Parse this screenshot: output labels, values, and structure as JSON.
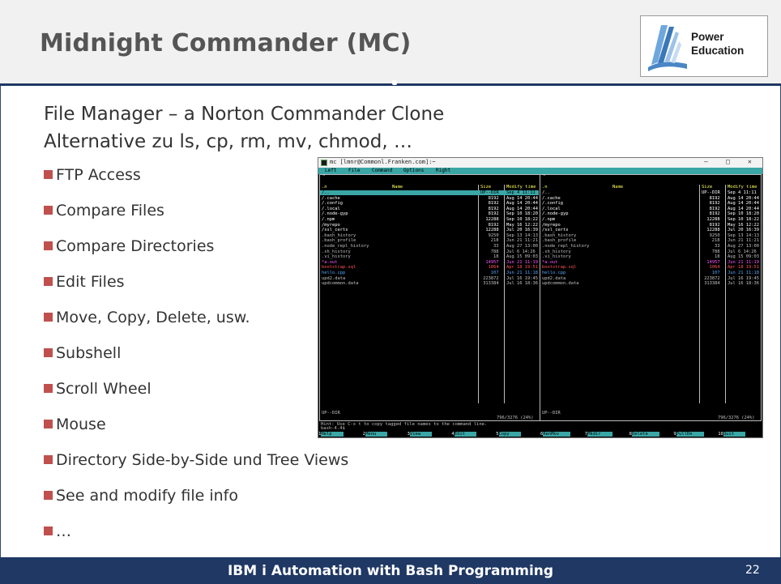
{
  "slide": {
    "title": "Midnight Commander (MC)",
    "subtitle_lines": [
      "File Manager – a Norton Commander Clone",
      "Alternative zu ls, cp, rm, mv, chmod, …"
    ],
    "bullets": [
      "FTP Access",
      "Compare Files",
      "Compare Directories",
      "Edit Files",
      "Move, Copy, Delete, usw.",
      "Subshell",
      "Scroll Wheel",
      "Mouse",
      "Directory Side-by-Side und Tree Views",
      "See and modify file info",
      "…"
    ],
    "bullet_color": "#c0504d",
    "footer_text": "IBM i Automation with Bash Programming",
    "page_number": "22",
    "logo": {
      "line1": "Power",
      "line2": "Education"
    },
    "colors": {
      "footer": "#1f3864",
      "header_bg": "#f1f1f1",
      "title": "#555555"
    }
  },
  "terminal": {
    "window_title": "mc [lmnr@Commonl.Franken.com]:~",
    "controls": [
      "–",
      "□",
      "✕"
    ],
    "menu": [
      "Left",
      "File",
      "Command",
      "Options",
      "Right"
    ],
    "panel_cwd_left": "~",
    "panel_cwd_right": "~",
    "col_headers": {
      "n": ".n",
      "name": "Name",
      "size": "Size",
      "mtime": "Modify time"
    },
    "files": [
      {
        "name": "/..",
        "size": "UP--DIR",
        "time": "Sep  4 11:11",
        "type": "dir"
      },
      {
        "name": "/.cache",
        "size": "8192",
        "time": "Aug 14 20:44",
        "type": "dir"
      },
      {
        "name": "/.config",
        "size": "8192",
        "time": "Aug 14 20:44",
        "type": "dir"
      },
      {
        "name": "/.local",
        "size": "8192",
        "time": "Aug 14 20:44",
        "type": "dir"
      },
      {
        "name": "/.node-gyp",
        "size": "8192",
        "time": "Sep 10 18:20",
        "type": "dir"
      },
      {
        "name": "/.npm",
        "size": "12288",
        "time": "Sep 10 18:22",
        "type": "dir"
      },
      {
        "name": "/myrepo",
        "size": "8192",
        "time": "May 16 12:22",
        "type": "dir"
      },
      {
        "name": "/ssl_certs",
        "size": "12288",
        "time": "Jul 20 16:39",
        "type": "dir"
      },
      {
        "name": ".bash_history",
        "size": "9250",
        "time": "Sep 13 14:13",
        "type": "file"
      },
      {
        "name": ".bash_profile",
        "size": "218",
        "time": "Jun 21 11:21",
        "type": "file"
      },
      {
        "name": ".node_repl_history",
        "size": "33",
        "time": "Aug 27 13:00",
        "type": "file"
      },
      {
        "name": ".sh_history",
        "size": "788",
        "time": "Jul  6 14:26",
        "type": "file"
      },
      {
        "name": ".vi_history",
        "size": "18",
        "time": "Aug 15 09:03",
        "type": "file"
      },
      {
        "name": "*a.out",
        "size": "14957",
        "time": "Jun 21 11:19",
        "type": "exec"
      },
      {
        "name": " bootstrap.sql",
        "size": "1064",
        "time": "Apr 18 19:51",
        "type": "red"
      },
      {
        "name": " hello.cpp",
        "size": "107",
        "time": "Jun 21 11:18",
        "type": "src"
      },
      {
        "name": " upd2.data",
        "size": "223872",
        "time": "Jul 16 19:45",
        "type": "file"
      },
      {
        "name": " updcommon.data",
        "size": "313384",
        "time": "Jul 16 18:36",
        "type": "file"
      }
    ],
    "status_left": "UP--DIR",
    "status_right": "796/3276 (24%)",
    "hint": "Hint: Use C-x t to copy tagged file names to the command line.",
    "prompt": "bash-4.4$",
    "fkeys": [
      {
        "num": "1",
        "label": "Help"
      },
      {
        "num": "2",
        "label": "Menu"
      },
      {
        "num": "3",
        "label": "View"
      },
      {
        "num": "4",
        "label": "Edit"
      },
      {
        "num": "5",
        "label": "Copy"
      },
      {
        "num": "6",
        "label": "RenMov"
      },
      {
        "num": "7",
        "label": "Mkdir"
      },
      {
        "num": "8",
        "label": "Delete"
      },
      {
        "num": "9",
        "label": "PullDn"
      },
      {
        "num": "10",
        "label": "Quit"
      }
    ],
    "colors": {
      "dir": "#ffffff",
      "file": "#c0c0c0",
      "exec": "#ff55ff",
      "red": "#ff5555",
      "src": "#55aaff",
      "cyan": "#3aa6a6"
    }
  }
}
